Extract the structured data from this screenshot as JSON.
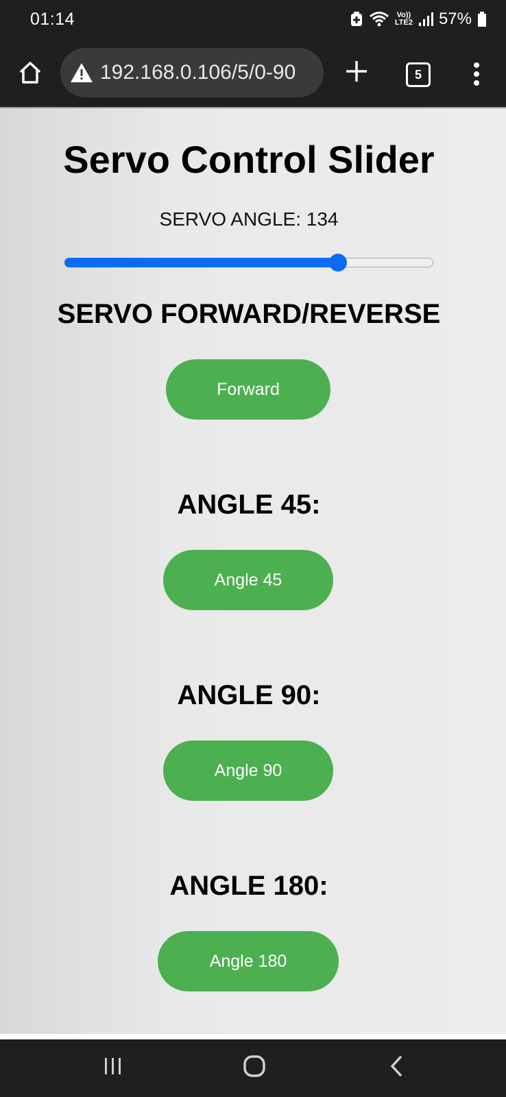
{
  "status_bar": {
    "time": "01:14",
    "network_label_top": "Vo))",
    "network_label_bottom": "LTE2",
    "battery_percent": "57%"
  },
  "browser": {
    "url": "192.168.0.106/5/0-90",
    "tab_count": "5",
    "icons": [
      "home-icon",
      "warning-icon",
      "new-tab-icon",
      "tabs-icon",
      "more-icon"
    ]
  },
  "page": {
    "title": "Servo Control Slider",
    "angle_label": "SERVO ANGLE: 134",
    "slider": {
      "min": 0,
      "max": 180,
      "value": 134
    },
    "sections": [
      {
        "heading": "SERVO FORWARD/REVERSE",
        "button_label": "Forward"
      },
      {
        "heading": "ANGLE 45:",
        "button_label": "Angle 45"
      },
      {
        "heading": "ANGLE 90:",
        "button_label": "Angle 90"
      },
      {
        "heading": "ANGLE 180:",
        "button_label": "Angle 180"
      }
    ],
    "colors": {
      "button_green": "#4caf50",
      "slider_blue": "#0a6cf5"
    }
  },
  "nav_bar": {
    "icons": [
      "recents-icon",
      "home-circle-icon",
      "back-icon"
    ]
  }
}
